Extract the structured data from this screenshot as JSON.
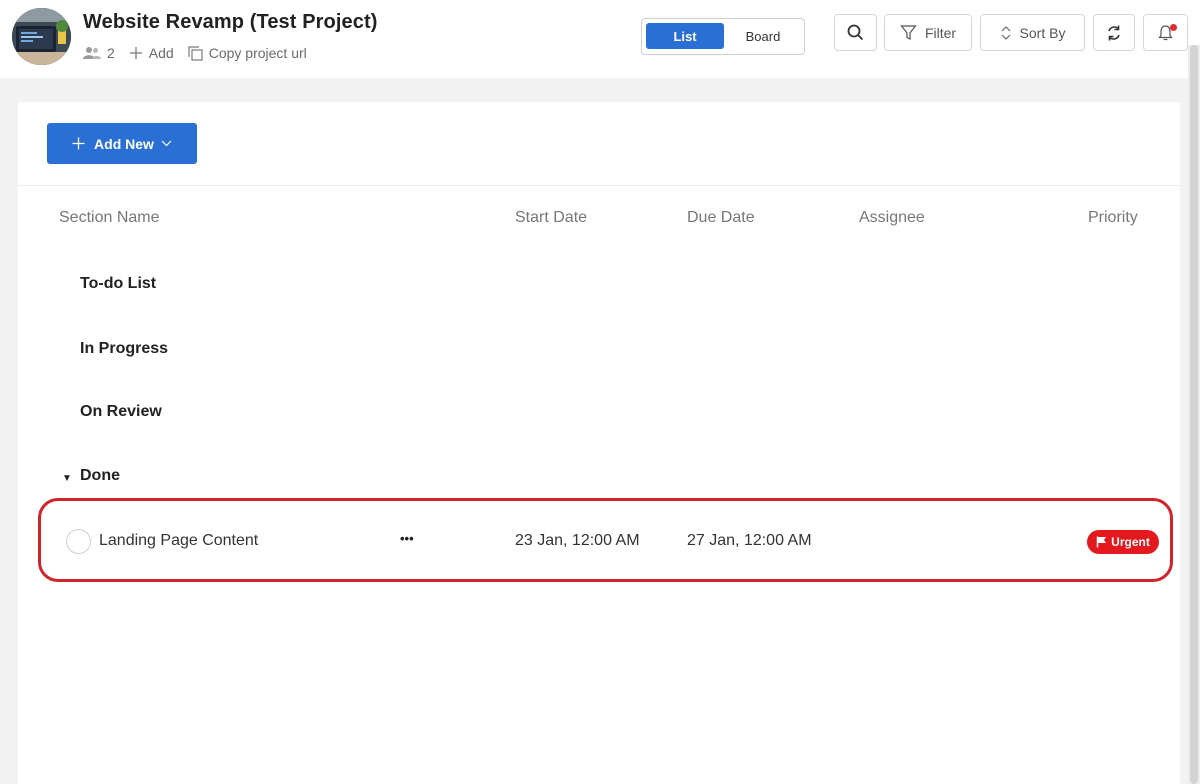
{
  "project": {
    "title": "Website Revamp (Test Project)",
    "member_count": "2",
    "add_label": "Add",
    "copy_url_label": "Copy project url"
  },
  "view_toggle": {
    "list": "List",
    "board": "Board",
    "selected": "List"
  },
  "toolbar": {
    "filter_label": "Filter",
    "sort_label": "Sort By",
    "has_notification": true
  },
  "panel": {
    "add_new_label": "Add New",
    "columns": [
      "Section Name",
      "Start Date",
      "Due Date",
      "Assignee",
      "Priority"
    ],
    "sections": [
      "To-do List",
      "In Progress",
      "On Review",
      "Done"
    ],
    "tasks": [
      {
        "section": "Done",
        "name": "Landing Page Content",
        "more": "•••",
        "start_date": "23 Jan, 12:00 AM",
        "due_date": "27 Jan, 12:00 AM",
        "assignee": "",
        "priority": "Urgent"
      }
    ]
  },
  "colors": {
    "accent": "#2a6fd4",
    "urgent": "#e3191d",
    "highlight": "#d3232a"
  }
}
